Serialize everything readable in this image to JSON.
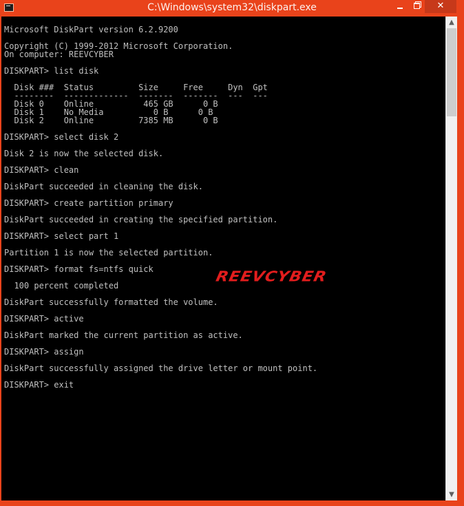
{
  "window": {
    "title": "C:\\Windows\\system32\\diskpart.exe",
    "icon": "console-icon",
    "controls": {
      "minimize_icon": "minimize-icon",
      "maximize_icon": "maximize-icon",
      "close_icon": "close-icon",
      "close_glyph": "✕"
    },
    "accent_color": "#e9431b"
  },
  "console": {
    "background": "#000000",
    "foreground": "#c0c0c0",
    "lines": [
      "Microsoft DiskPart version 6.2.9200",
      "",
      "Copyright (C) 1999-2012 Microsoft Corporation.",
      "On computer: REEVCYBER",
      "",
      "DISKPART> list disk",
      "",
      "  Disk ###  Status         Size     Free     Dyn  Gpt",
      "  --------  -------------  -------  -------  ---  ---",
      "  Disk 0    Online          465 GB      0 B",
      "  Disk 1    No Media          0 B      0 B",
      "  Disk 2    Online         7385 MB      0 B",
      "",
      "DISKPART> select disk 2",
      "",
      "Disk 2 is now the selected disk.",
      "",
      "DISKPART> clean",
      "",
      "DiskPart succeeded in cleaning the disk.",
      "",
      "DISKPART> create partition primary",
      "",
      "DiskPart succeeded in creating the specified partition.",
      "",
      "DISKPART> select part 1",
      "",
      "Partition 1 is now the selected partition.",
      "",
      "DISKPART> format fs=ntfs quick",
      "",
      "  100 percent completed",
      "",
      "DiskPart successfully formatted the volume.",
      "",
      "DISKPART> active",
      "",
      "DiskPart marked the current partition as active.",
      "",
      "DISKPART> assign",
      "",
      "DiskPart successfully assigned the drive letter or mount point.",
      "",
      "DISKPART> exit"
    ]
  },
  "watermark": {
    "text": "REEVCYBER",
    "color": "#e21d1d"
  },
  "scrollbar": {
    "up_glyph": "▲",
    "down_glyph": "▼",
    "up_icon": "scroll-up-arrow-icon",
    "down_icon": "scroll-down-arrow-icon"
  }
}
